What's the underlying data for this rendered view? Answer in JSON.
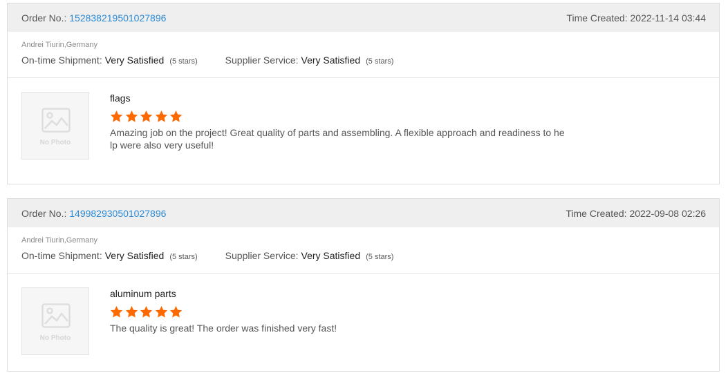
{
  "labels": {
    "order_no": "Order No.:",
    "time_created": "Time Created:",
    "on_time_shipment": "On-time Shipment:",
    "supplier_service": "Supplier Service:",
    "no_photo": "No Photo"
  },
  "colors": {
    "link": "#2b8ad6",
    "star": "#ff6a00",
    "header_bg": "#efefef"
  },
  "reviews": [
    {
      "order_no": "152838219501027896",
      "time_created": "2022-11-14 03:44",
      "buyer": "Andrei Tiurin,Germany",
      "on_time_shipment": "Very Satisfied",
      "on_time_shipment_stars": "(5 stars)",
      "supplier_service": "Very Satisfied",
      "supplier_service_stars": "(5 stars)",
      "product_name": "flags",
      "rating": 5,
      "comment": "Amazing job on the project! Great quality of parts and assembling. A flexible approach and readiness to help were also very useful!",
      "photo_icon": "image-placeholder-icon"
    },
    {
      "order_no": "149982930501027896",
      "time_created": "2022-09-08 02:26",
      "buyer": "Andrei Tiurin,Germany",
      "on_time_shipment": "Very Satisfied",
      "on_time_shipment_stars": "(5 stars)",
      "supplier_service": "Very Satisfied",
      "supplier_service_stars": "(5 stars)",
      "product_name": "aluminum parts",
      "rating": 5,
      "comment": "The quality is great! The order was finished very fast!",
      "photo_icon": "image-placeholder-icon"
    }
  ]
}
